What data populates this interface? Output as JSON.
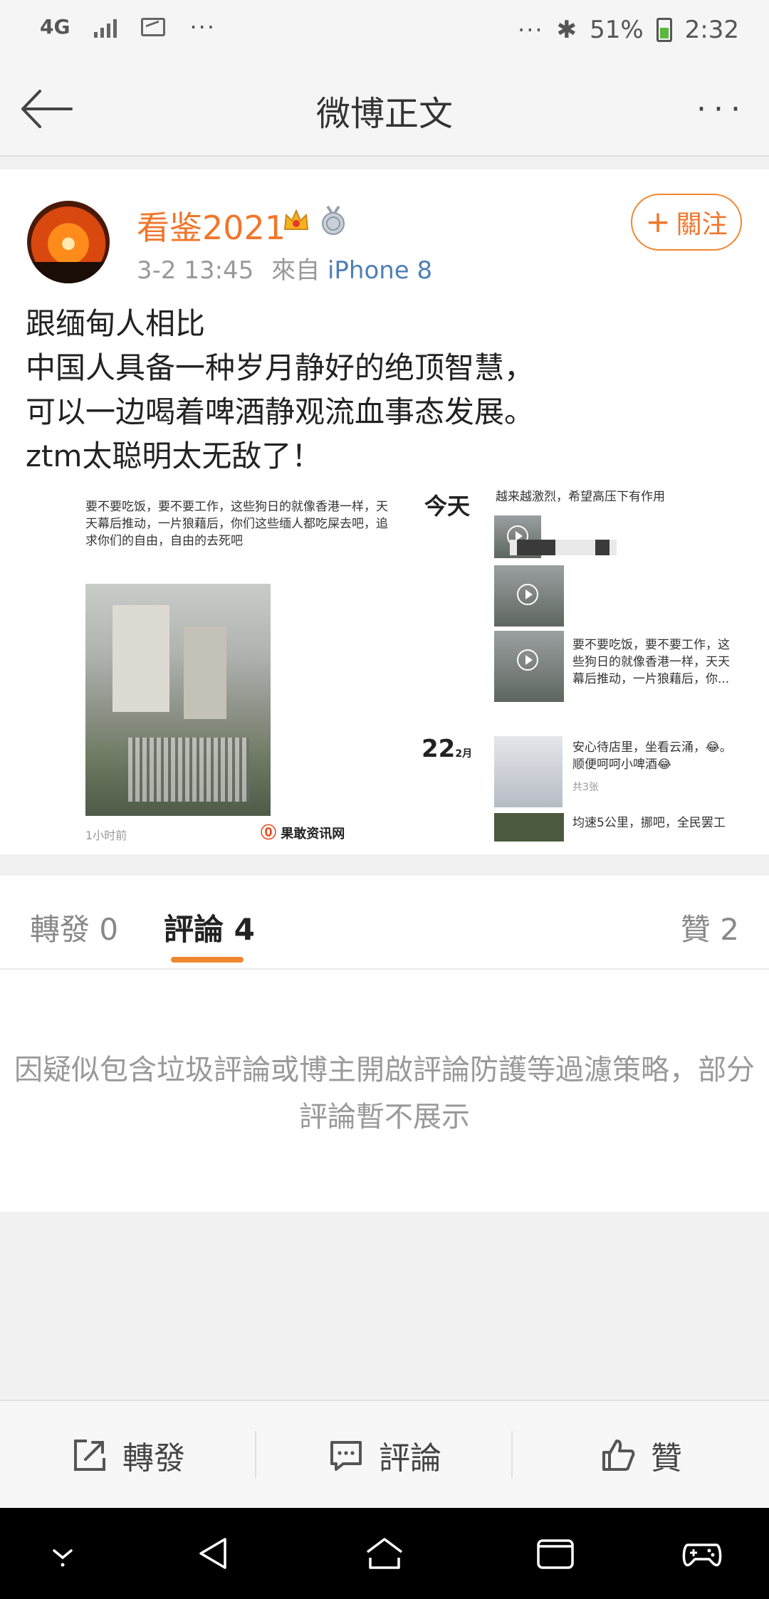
{
  "status_bar": {
    "network": "4G",
    "more_left": "···",
    "more_right": "···",
    "bluetooth": "✱",
    "battery": "51%",
    "time": "2:32"
  },
  "nav": {
    "title": "微博正文",
    "more": "···"
  },
  "post": {
    "username": "看鉴2021",
    "timestamp": "3-2 13:45",
    "source_prefix": "來自",
    "source": "iPhone 8",
    "follow_label": "關注",
    "text_lines": [
      "跟缅甸人相比",
      "中国人具备一种岁月静好的绝顶智慧，",
      "可以一边喝着啤酒静观流血事态发展。",
      "ztm太聪明太无敌了！"
    ],
    "image": {
      "left_caption": "要不要吃饭，要不要工作，这些狗日的就像香港一样，天天幕后推动，一片狼藉后，你们这些缅人都吃屎去吧，追求你们的自由，自由的去死吧",
      "left_time": "1小时前",
      "left_logo": "果敢资讯网",
      "today_label": "今天",
      "note_1": "越来越激烈，希望高压下有作用",
      "note_2": "要不要吃饭，要不要工作，这些狗日的就像香港一样，天天幕后推动，一片狼藉后，你...",
      "date_day": "22",
      "date_month": "2月",
      "note_3": "安心待店里，坐看云涌，😂。顺便呵呵小啤酒😂",
      "note_4": "共3张",
      "note_5": "均速5公里，挪吧，全民罢工"
    }
  },
  "tabs": {
    "repost": "轉發 0",
    "comments": "評論 4",
    "likes": "贊 2"
  },
  "comments": {
    "notice": "因疑似包含垃圾評論或博主開啟評論防護等過濾策略，部分評論暫不展示"
  },
  "actions": {
    "repost": "轉發",
    "comment": "評論",
    "like": "贊"
  },
  "colors": {
    "accent": "#f0762b",
    "link": "#4f7fb5",
    "muted": "#999999"
  }
}
